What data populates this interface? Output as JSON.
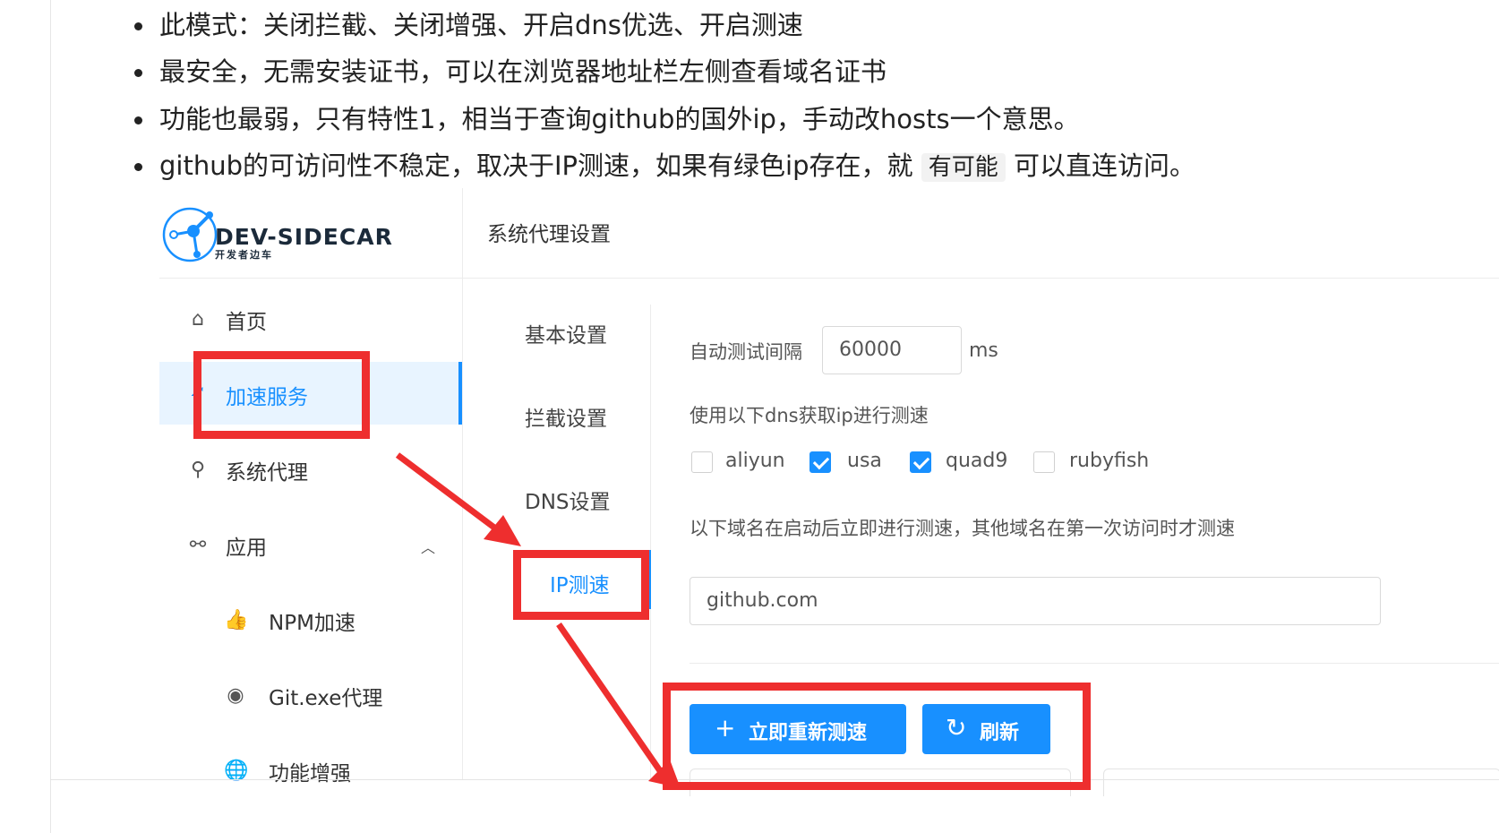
{
  "bullets": [
    {
      "text": "此模式：关闭拦截、关闭增强、开启dns优选、开启测速"
    },
    {
      "text": "最安全，无需安装证书，可以在浏览器地址栏左侧查看域名证书"
    },
    {
      "text": "功能也最弱，只有特性1，相当于查询github的国外ip，手动改hosts一个意思。"
    },
    {
      "text_before": "github的可访问性不稳定，取决于IP测速，如果有绿色ip存在，就",
      "code": "有可能",
      "text_after": "可以直连访问。"
    }
  ],
  "app": {
    "logo": {
      "title": "DEV-SIDECAR",
      "subtitle": "开发者边车"
    },
    "header_title": "系统代理设置",
    "sidebar": [
      {
        "label": "首页",
        "icon": "home-icon"
      },
      {
        "label": "加速服务",
        "icon": "rocket-icon",
        "active": true
      },
      {
        "label": "系统代理",
        "icon": "network-icon"
      },
      {
        "label": "应用",
        "icon": "api-icon",
        "expanded": true
      },
      {
        "label": "NPM加速",
        "icon": "thumbs-up-icon"
      },
      {
        "label": "Git.exe代理",
        "icon": "github-icon"
      },
      {
        "label": "功能增强",
        "icon": "globe-icon"
      }
    ],
    "submenu": [
      {
        "label": "基本设置"
      },
      {
        "label": "拦截设置"
      },
      {
        "label": "DNS设置"
      },
      {
        "label": "IP测速",
        "active": true
      }
    ],
    "form": {
      "interval_label": "自动测试间隔",
      "interval_value": "60000",
      "interval_unit": "ms",
      "dns_label": "使用以下dns获取ip进行测速",
      "dns_options": [
        {
          "label": "aliyun",
          "checked": false
        },
        {
          "label": "usa",
          "checked": true
        },
        {
          "label": "quad9",
          "checked": true
        },
        {
          "label": "rubyfish",
          "checked": false
        }
      ],
      "domains_label": "以下域名在启动后立即进行测速，其他域名在第一次访问时才测速",
      "domain_value": "github.com",
      "retest_button": "立即重新测速",
      "refresh_button": "刷新"
    }
  },
  "colors": {
    "accent": "#1890ff",
    "annotation": "#ee2e2e",
    "active_bg": "#e8f4ff"
  }
}
